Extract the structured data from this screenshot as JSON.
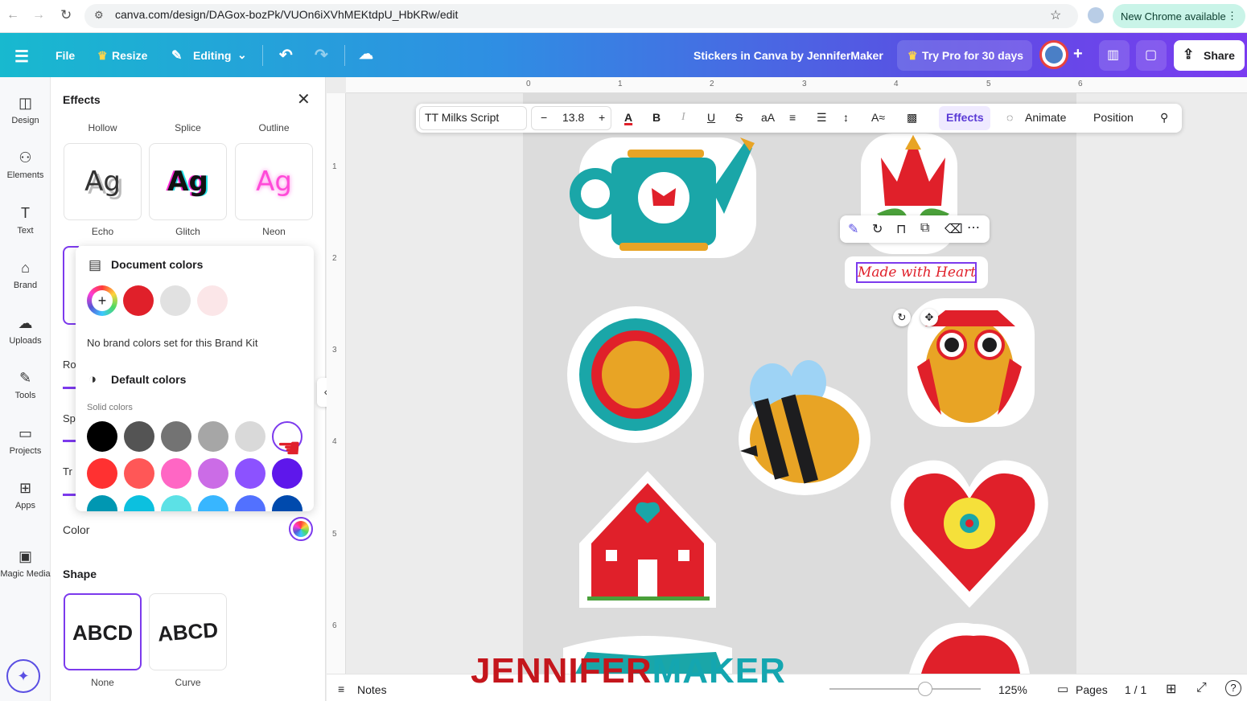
{
  "browser": {
    "url": "canva.com/design/DAGox-bozPk/VUOn6iXVhMEKtdpU_HbKRw/edit",
    "update_label": "New Chrome available"
  },
  "topbar": {
    "file": "File",
    "resize": "Resize",
    "editing": "Editing",
    "title": "Stickers in Canva by JenniferMaker",
    "try_pro": "Try Pro for 30 days",
    "share": "Share"
  },
  "rail": {
    "items": [
      {
        "label": "Design",
        "icon": "design-icon"
      },
      {
        "label": "Elements",
        "icon": "elements-icon"
      },
      {
        "label": "Text",
        "icon": "text-icon"
      },
      {
        "label": "Brand",
        "icon": "brand-icon"
      },
      {
        "label": "Uploads",
        "icon": "uploads-icon"
      },
      {
        "label": "Tools",
        "icon": "tools-icon"
      },
      {
        "label": "Projects",
        "icon": "projects-icon"
      },
      {
        "label": "Apps",
        "icon": "apps-icon"
      },
      {
        "label": "Magic Media",
        "icon": "magic-media-icon"
      }
    ]
  },
  "effects_panel": {
    "title": "Effects",
    "top_labels": [
      "Hollow",
      "Splice",
      "Outline"
    ],
    "cards": [
      {
        "sample": "Ag",
        "label": "Echo"
      },
      {
        "sample": "Ag",
        "label": "Glitch"
      },
      {
        "sample": "Ag",
        "label": "Neon"
      }
    ],
    "hidden_labels": [
      "Ro",
      "Sp",
      "Tr"
    ],
    "color_label": "Color",
    "shape_heading": "Shape",
    "shapes": [
      {
        "sample": "ABCD",
        "label": "None"
      },
      {
        "sample": "ABCD",
        "label": "Curve"
      }
    ]
  },
  "color_popup": {
    "document_colors_heading": "Document colors",
    "document_colors": [
      "#e0202a",
      "#e1e1e1",
      "#fbe6e8"
    ],
    "brand_note": "No brand colors set for this Brand Kit",
    "default_colors_heading": "Default colors",
    "solid_label": "Solid colors",
    "solid_row1": [
      "#000000",
      "#545454",
      "#737373",
      "#a6a6a6",
      "#d9d9d9",
      "#ffffff"
    ],
    "solid_row2": [
      "#ff3131",
      "#ff5757",
      "#ff66c4",
      "#cb6ce6",
      "#8c52ff",
      "#5e17eb"
    ],
    "solid_row3": [
      "#0097b2",
      "#0cc0df",
      "#5ce1e6",
      "#38b6ff",
      "#5271ff",
      "#004aad"
    ]
  },
  "text_toolbar": {
    "font": "TT Milks Script",
    "size": "13.8",
    "effects": "Effects",
    "animate": "Animate",
    "position": "Position"
  },
  "canvas": {
    "selected_text": "Made with Heart",
    "ruler_top": [
      "0",
      "1",
      "2",
      "3",
      "4",
      "5",
      "6"
    ],
    "ruler_left": [
      "1",
      "2",
      "3",
      "4",
      "5",
      "6"
    ]
  },
  "bottom": {
    "notes": "Notes",
    "zoom": "125%",
    "pages": "Pages",
    "page_count": "1 / 1"
  },
  "watermark": {
    "part1": "JENNIFER",
    "part2": "MAKER"
  }
}
